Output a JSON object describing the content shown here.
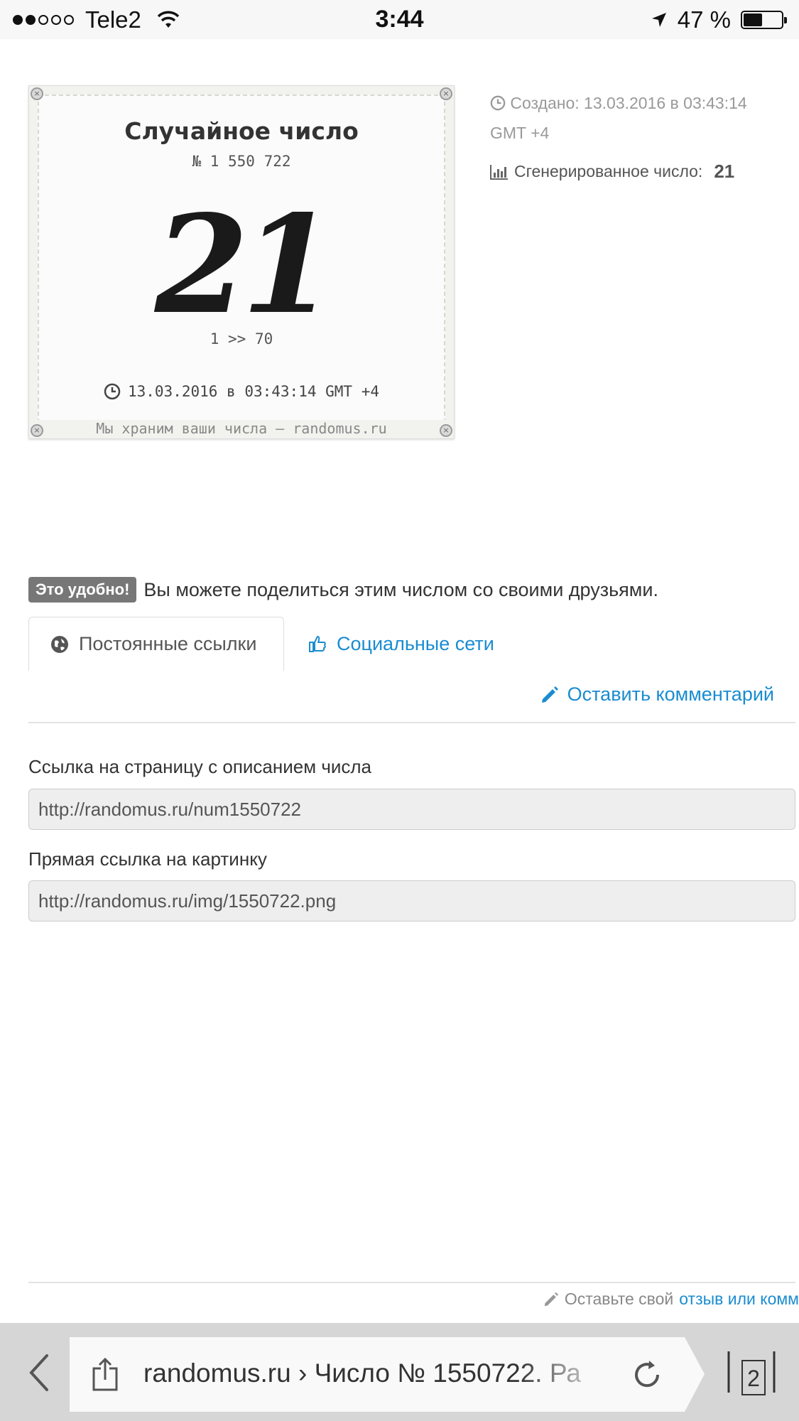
{
  "status_bar": {
    "signal_filled": 2,
    "signal_total": 5,
    "carrier": "Tele2",
    "time": "3:44",
    "battery_percent_label": "47 %",
    "battery_level": 0.47
  },
  "card": {
    "title": "Случайное число",
    "number_label": "№  1 550 722",
    "value": "21",
    "range": "1 >> 70",
    "date": "13.03.2016 в 03:43:14 GMT +4",
    "footer": "Мы храним ваши числа — randomus.ru"
  },
  "meta": {
    "created": "Создано: 13.03.2016 в 03:43:14 GMT +4",
    "generated_label": "Сгенерированное число:",
    "generated_value": "21"
  },
  "share": {
    "badge": "Это удобно!",
    "text": "Вы можете поделиться этим числом со своими друзьями."
  },
  "tabs": [
    {
      "label": "Постоянные ссылки",
      "icon": "globe-icon",
      "active": true
    },
    {
      "label": "Социальные сети",
      "icon": "thumbs-up-icon",
      "active": false
    }
  ],
  "comment_link": "Оставить комментарий",
  "fields": [
    {
      "label": "Ссылка на страницу с описанием числа",
      "value": "http://randomus.ru/num1550722"
    },
    {
      "label": "Прямая ссылка на картинку",
      "value": "http://randomus.ru/img/1550722.png"
    }
  ],
  "feedback": {
    "text": "Оставьте свой",
    "link": "отзыв или комм"
  },
  "browser": {
    "url_text": "randomus.ru › Число № 1550722. Ра",
    "tab_count": "2"
  },
  "colors": {
    "link": "#1a8cd0",
    "badge": "#777777",
    "toolbar": "#d6d6d6"
  }
}
